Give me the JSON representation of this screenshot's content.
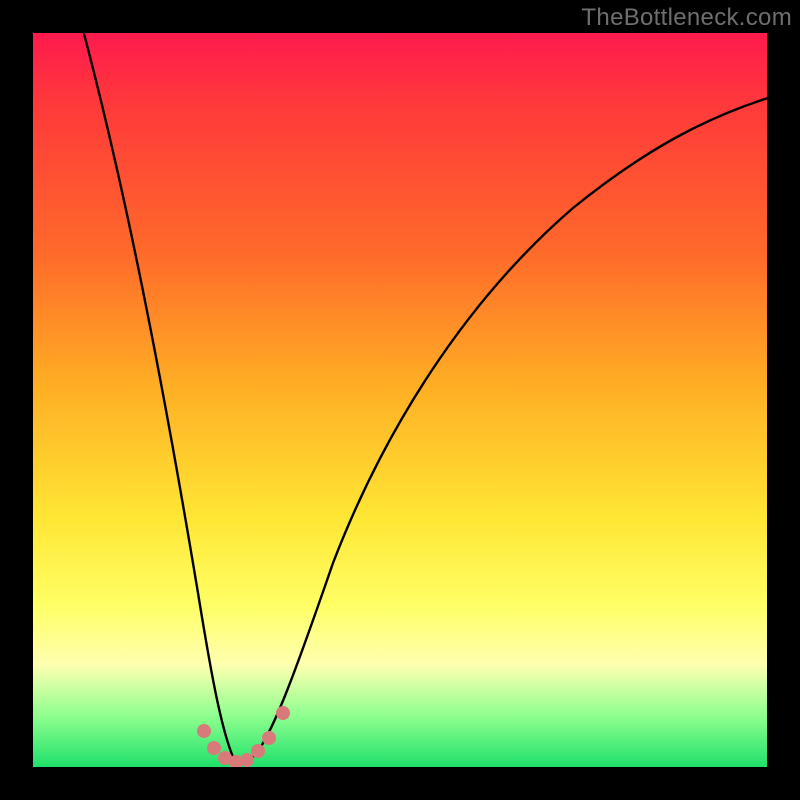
{
  "attribution": "TheBottleneck.com",
  "colors": {
    "frame": "#000000",
    "gradient_top": "#ff1a4d",
    "gradient_mid_upper": "#ff6a2a",
    "gradient_mid": "#ffe634",
    "gradient_mid_lower": "#ffff9a",
    "gradient_bottom": "#1fe06a",
    "curve": "#000000",
    "marker": "#d97a7a"
  },
  "chart_data": {
    "type": "line",
    "title": "",
    "xlabel": "",
    "ylabel": "",
    "x_units": "relative (0–1 across plot width)",
    "y_units": "bottleneck % (0 = no bottleneck, 100 = full bottleneck)",
    "ylim": [
      0,
      100
    ],
    "xlim": [
      0,
      1
    ],
    "gradient_meaning": "color encodes bottleneck severity: green low, red high",
    "series": [
      {
        "name": "bottleneck-curve",
        "x": [
          0.0,
          0.03,
          0.06,
          0.09,
          0.12,
          0.15,
          0.18,
          0.21,
          0.24,
          0.255,
          0.27,
          0.285,
          0.3,
          0.32,
          0.34,
          0.38,
          0.44,
          0.52,
          0.62,
          0.74,
          0.88,
          1.0
        ],
        "values": [
          136,
          120,
          104,
          88,
          72,
          56,
          40,
          24,
          8,
          1.5,
          0.5,
          0.5,
          1.5,
          6,
          14,
          28,
          44,
          58,
          70,
          80,
          88,
          93
        ]
      }
    ],
    "markers": {
      "name": "highlighted-points",
      "x": [
        0.225,
        0.24,
        0.255,
        0.27,
        0.285,
        0.3,
        0.315,
        0.335
      ],
      "values": [
        5,
        2,
        0.8,
        0.5,
        0.5,
        1.2,
        2.5,
        7
      ],
      "note": "cluster of salmon-colored data points near the curve minimum"
    },
    "minimum_at_x": 0.278
  }
}
